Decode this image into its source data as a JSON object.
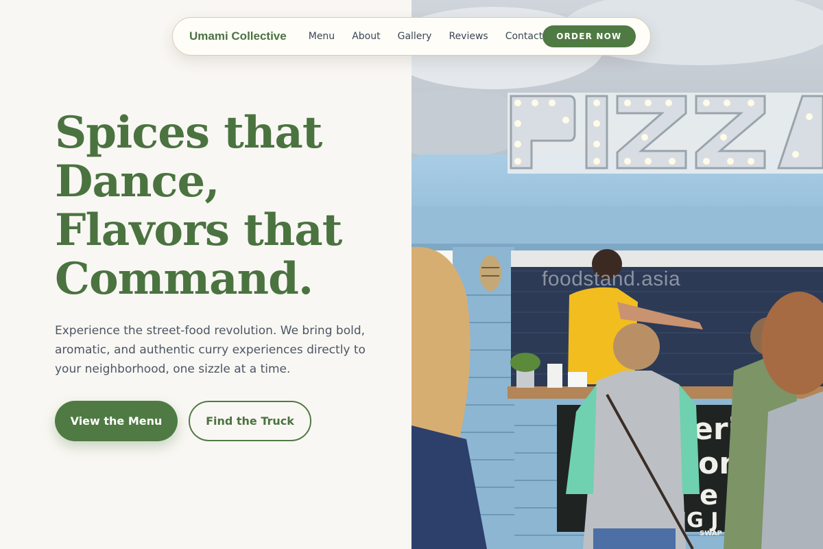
{
  "nav": {
    "brand": "Umami Collective",
    "links": [
      "Menu",
      "About",
      "Gallery",
      "Reviews",
      "Contact"
    ],
    "cta": "ORDER NOW"
  },
  "hero": {
    "headline_lines": [
      "Spices that",
      "Dance,",
      "Flavors that",
      "Command."
    ],
    "subtext": "Experience the street-food revolution. We bring bold, aromatic, and authentic curry experiences directly to your neighborhood, one sizzle at a time.",
    "primary_button": "View the Menu",
    "secondary_button": "Find the Truck",
    "image": {
      "sign_text": "PIZZA",
      "watermark": "foodstand.asia",
      "chalkboard_fragments": [
        "erit",
        "oni",
        "e -",
        "IG J",
        "SWAP FOR VE"
      ]
    }
  },
  "colors": {
    "accent": "#4f7a43",
    "headline": "#4a7340",
    "background": "#f9f7f3",
    "truck_blue": "#9cc3dc"
  }
}
